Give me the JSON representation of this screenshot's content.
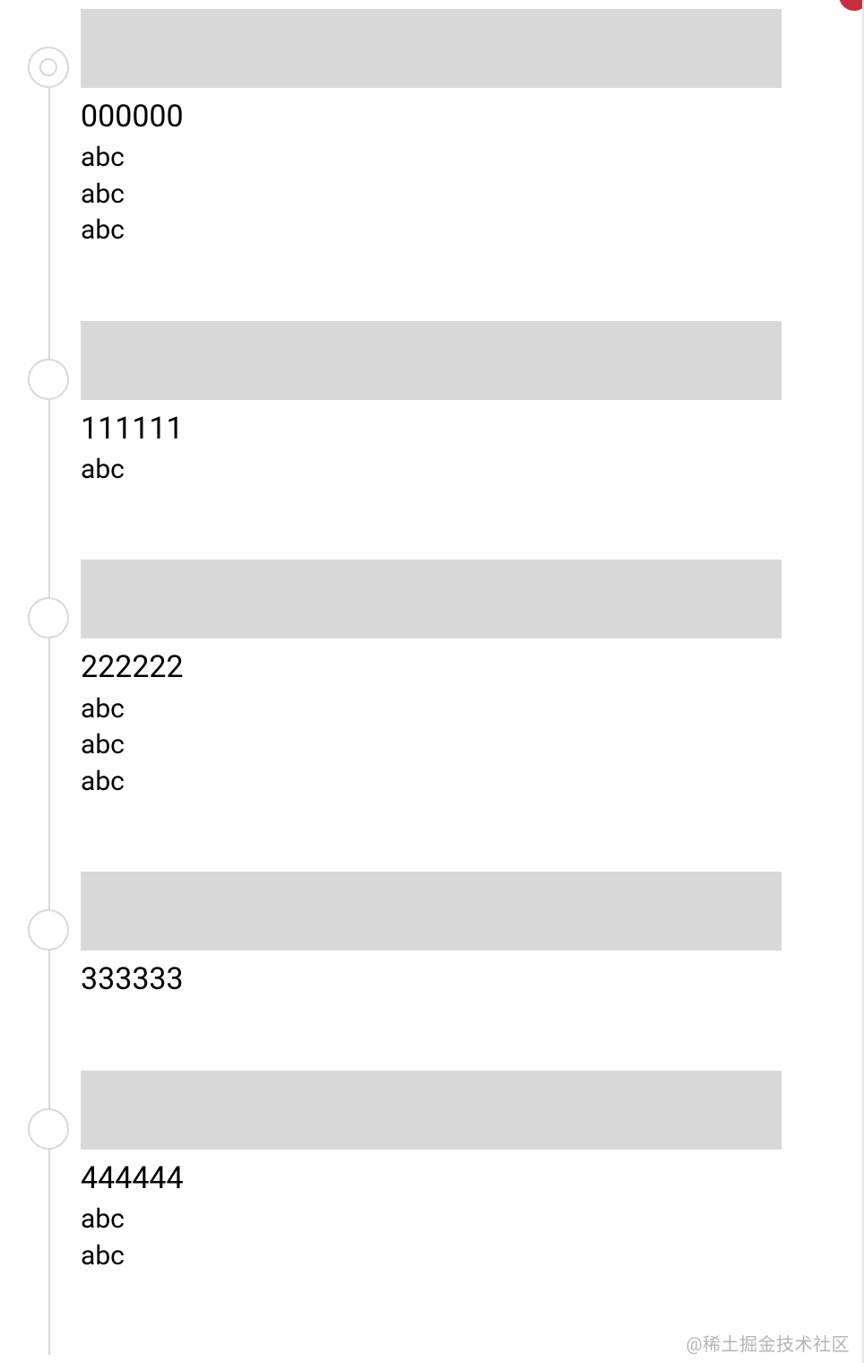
{
  "timeline": {
    "items": [
      {
        "title": "000000",
        "lines": [
          "abc",
          "abc",
          "abc"
        ],
        "active": true
      },
      {
        "title": "111111",
        "lines": [
          "abc"
        ],
        "active": false
      },
      {
        "title": "222222",
        "lines": [
          "abc",
          "abc",
          "abc"
        ],
        "active": false
      },
      {
        "title": "333333",
        "lines": [],
        "active": false
      },
      {
        "title": "444444",
        "lines": [
          "abc",
          "abc"
        ],
        "active": false
      }
    ]
  },
  "watermark": "@稀土掘金技术社区"
}
